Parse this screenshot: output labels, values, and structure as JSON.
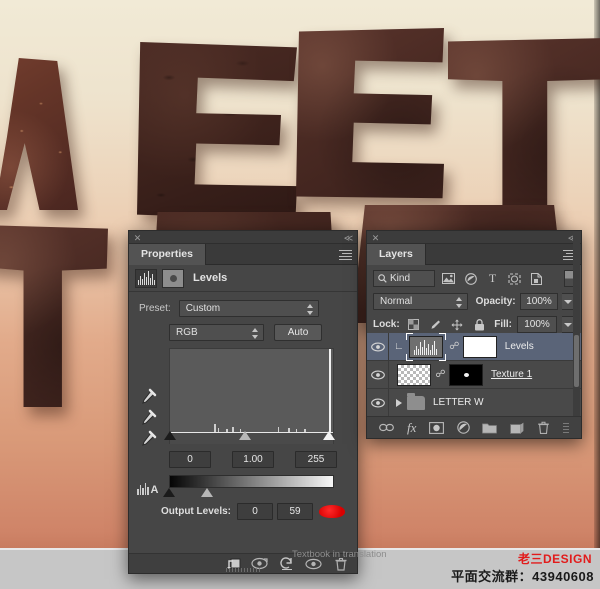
{
  "app": {
    "background": {
      "artwork_letters": [
        "W",
        "E",
        "E",
        "T"
      ],
      "gradient_top": "#f1ead6",
      "gradient_bottom": "#c87c60",
      "strip_color": "#c6c6c6"
    }
  },
  "properties_panel": {
    "titlebar": {
      "close_icon": "close-icon",
      "collapse_icon": "collapse-left-icon"
    },
    "tab_label": "Properties",
    "menu_icon": "panel-menu-icon",
    "adjustment_icon": "levels-histogram-icon",
    "mask_icon": "layer-mask-icon",
    "title": "Levels",
    "preset": {
      "label": "Preset:",
      "value": "Custom"
    },
    "channel": {
      "value": "RGB"
    },
    "auto_button": "Auto",
    "eyedroppers": [
      "black-point-eyedropper-icon",
      "gray-point-eyedropper-icon",
      "white-point-eyedropper-icon"
    ],
    "auto_options_icon": "auto-options-icon",
    "input_levels": {
      "shadow": "0",
      "midtone": "1.00",
      "highlight": "255"
    },
    "output_levels": {
      "label": "Output Levels:",
      "shadow": "0",
      "highlight": "59"
    },
    "cursor_marker_color": "#e30000",
    "footer_buttons": [
      "clip-to-layer-icon",
      "view-previous-state-icon",
      "reset-icon",
      "toggle-layer-visibility-icon",
      "delete-layer-icon"
    ]
  },
  "layers_panel": {
    "titlebar": {
      "close_icon": "close-icon",
      "collapse_icon": "collapse-left-icon"
    },
    "tab_label": "Layers",
    "menu_icon": "panel-menu-icon",
    "filter": {
      "kind_label": "Kind",
      "search_icon": "search-icon",
      "icons": [
        "pixel-layer-filter-icon",
        "adjustment-layer-filter-icon",
        "type-layer-filter-icon",
        "shape-layer-filter-icon",
        "smart-object-filter-icon"
      ],
      "toggle_icon": "filter-toggle-icon"
    },
    "blend_mode": "Normal",
    "opacity": {
      "label": "Opacity:",
      "value": "100%"
    },
    "lock": {
      "label": "Lock:",
      "icons": [
        "lock-transparent-pixels-icon",
        "lock-image-pixels-icon",
        "lock-position-icon",
        "lock-all-icon"
      ]
    },
    "fill": {
      "label": "Fill:",
      "value": "100%"
    },
    "layers": [
      {
        "name": "Levels",
        "visible": true,
        "selected": true,
        "type": "adjustment",
        "clipped": true,
        "linked": true,
        "has_mask": true,
        "eye_icon": "eye-icon"
      },
      {
        "name": "Texture 1",
        "visible": true,
        "selected": false,
        "type": "pixel",
        "clipped": false,
        "linked": true,
        "has_mask": true,
        "editing": true,
        "eye_icon": "eye-icon"
      },
      {
        "name": "LETTER W",
        "visible": true,
        "selected": false,
        "type": "group",
        "expanded": false,
        "eye_icon": "eye-icon"
      }
    ],
    "footer_buttons": [
      "link-layers-icon",
      "layer-style-fx-icon",
      "add-layer-mask-icon",
      "new-adjustment-layer-icon",
      "new-group-icon",
      "new-layer-icon",
      "delete-layer-icon"
    ]
  },
  "watermarks": {
    "translation": "Textbook in translation",
    "logo": "老三DESIGN",
    "qq_group": "平面交流群：43940608"
  }
}
